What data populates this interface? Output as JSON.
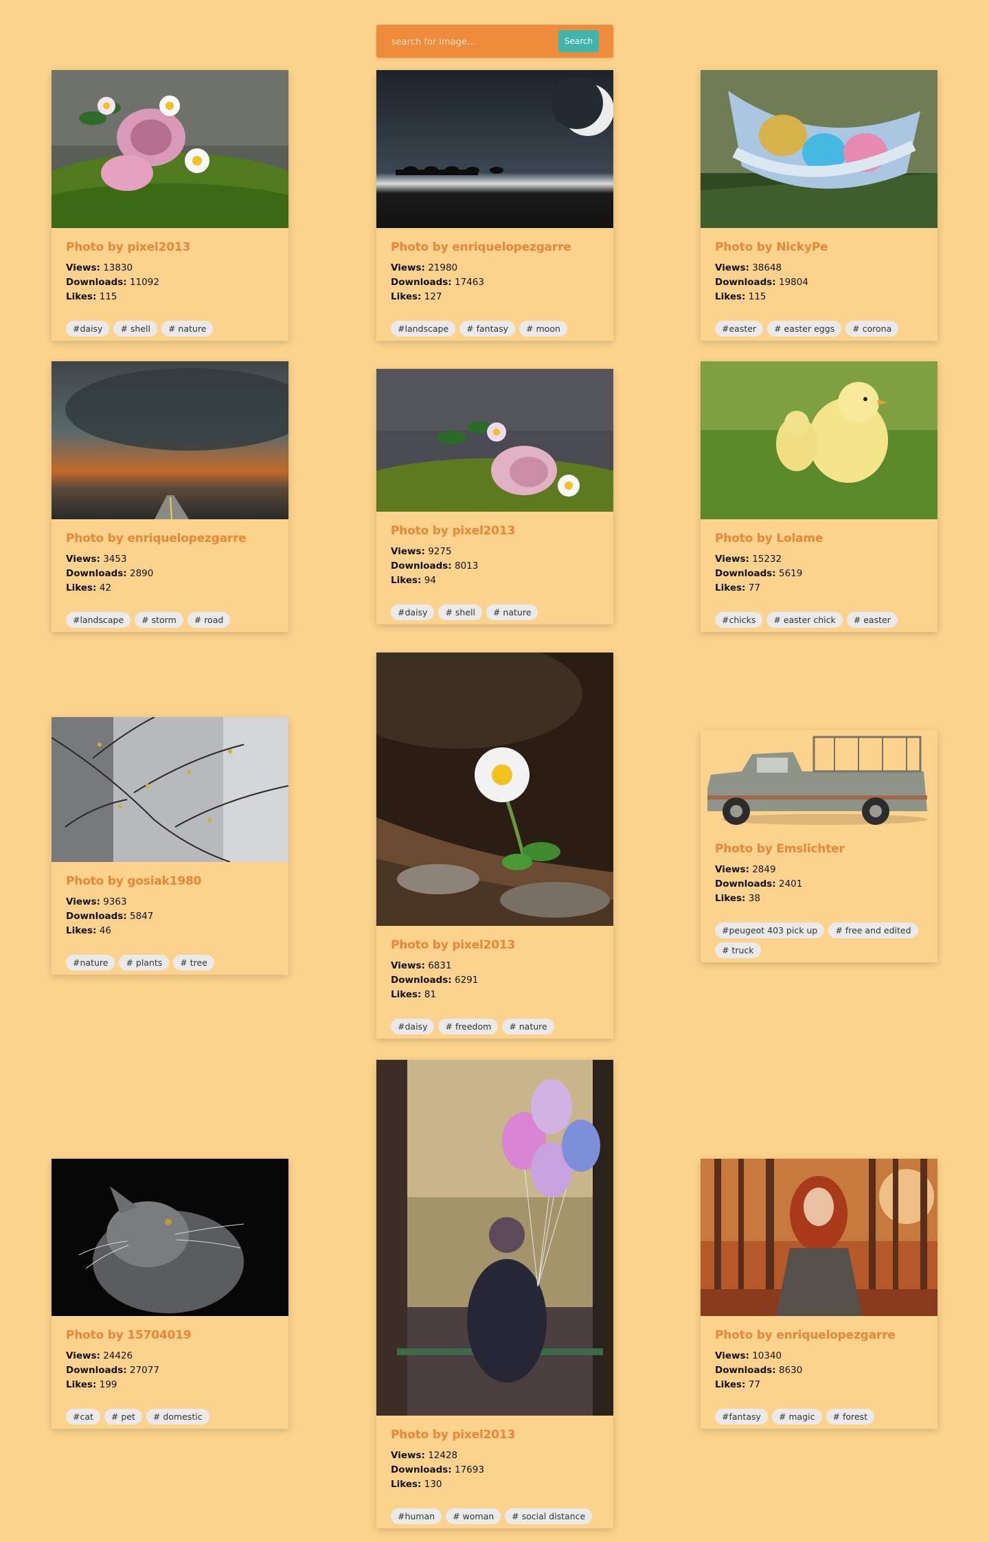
{
  "search": {
    "placeholder": "search for image...",
    "button_label": "Search"
  },
  "cards": [
    {
      "author": "Photo by pixel2013",
      "views_label": "Views:",
      "views": "13830",
      "downloads_label": "Downloads:",
      "downloads": "11092",
      "likes_label": "Likes:",
      "likes": "115",
      "tags": [
        "#daisy",
        "# shell",
        "# nature"
      ]
    },
    {
      "author": "Photo by enriquelopezgarre",
      "views_label": "Views:",
      "views": "21980",
      "downloads_label": "Downloads:",
      "downloads": "17463",
      "likes_label": "Likes:",
      "likes": "127",
      "tags": [
        "#landscape",
        "# fantasy",
        "# moon"
      ]
    },
    {
      "author": "Photo by NickyPe",
      "views_label": "Views:",
      "views": "38648",
      "downloads_label": "Downloads:",
      "downloads": "19804",
      "likes_label": "Likes:",
      "likes": "115",
      "tags": [
        "#easter",
        "# easter eggs",
        "# corona"
      ]
    },
    {
      "author": "Photo by enriquelopezgarre",
      "views_label": "Views:",
      "views": "3453",
      "downloads_label": "Downloads:",
      "downloads": "2890",
      "likes_label": "Likes:",
      "likes": "42",
      "tags": [
        "#landscape",
        "# storm",
        "# road"
      ]
    },
    {
      "author": "Photo by pixel2013",
      "views_label": "Views:",
      "views": "9275",
      "downloads_label": "Downloads:",
      "downloads": "8013",
      "likes_label": "Likes:",
      "likes": "94",
      "tags": [
        "#daisy",
        "# shell",
        "# nature"
      ]
    },
    {
      "author": "Photo by Lolame",
      "views_label": "Views:",
      "views": "15232",
      "downloads_label": "Downloads:",
      "downloads": "5619",
      "likes_label": "Likes:",
      "likes": "77",
      "tags": [
        "#chicks",
        "# easter chick",
        "# easter"
      ]
    },
    {
      "author": "Photo by gosiak1980",
      "views_label": "Views:",
      "views": "9363",
      "downloads_label": "Downloads:",
      "downloads": "5847",
      "likes_label": "Likes:",
      "likes": "46",
      "tags": [
        "#nature",
        "# plants",
        "# tree"
      ]
    },
    {
      "author": "Photo by pixel2013",
      "views_label": "Views:",
      "views": "6831",
      "downloads_label": "Downloads:",
      "downloads": "6291",
      "likes_label": "Likes:",
      "likes": "81",
      "tags": [
        "#daisy",
        "# freedom",
        "# nature"
      ]
    },
    {
      "author": "Photo by Emslichter",
      "views_label": "Views:",
      "views": "2849",
      "downloads_label": "Downloads:",
      "downloads": "2401",
      "likes_label": "Likes:",
      "likes": "38",
      "tags": [
        "#peugeot 403 pick up",
        "# free and edited",
        "# truck"
      ]
    },
    {
      "author": "Photo by 15704019",
      "views_label": "Views:",
      "views": "24426",
      "downloads_label": "Downloads:",
      "downloads": "27077",
      "likes_label": "Likes:",
      "likes": "199",
      "tags": [
        "#cat",
        "# pet",
        "# domestic"
      ]
    },
    {
      "author": "Photo by pixel2013",
      "views_label": "Views:",
      "views": "12428",
      "downloads_label": "Downloads:",
      "downloads": "17693",
      "likes_label": "Likes:",
      "likes": "130",
      "tags": [
        "#human",
        "# woman",
        "# social distance"
      ]
    },
    {
      "author": "Photo by enriquelopezgarre",
      "views_label": "Views:",
      "views": "10340",
      "downloads_label": "Downloads:",
      "downloads": "8630",
      "likes_label": "Likes:",
      "likes": "77",
      "tags": [
        "#fantasy",
        "# magic",
        "# forest"
      ]
    }
  ]
}
